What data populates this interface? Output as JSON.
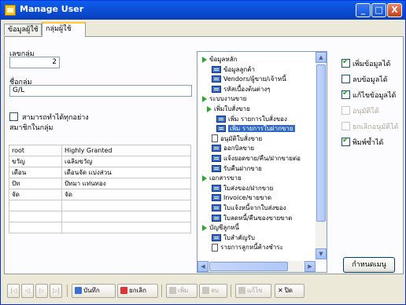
{
  "window": {
    "title": "Manage User",
    "minimize": "_",
    "maximize": "□",
    "close": "X"
  },
  "tabs": [
    {
      "label": "ข้อมูลผู้ใช้"
    },
    {
      "label": "กลุ่มผู้ใช้"
    }
  ],
  "form": {
    "group_no_label": "เลขกลุ่ม",
    "group_no_value": "2",
    "group_name_label": "ชื่อกลุ่ม",
    "group_name_value": "G/L",
    "can_do_all_label": "สามารถทำได้ทุกอย่าง",
    "members_label": "สมาชิกในกลุ่ม"
  },
  "members": [
    {
      "user": "root",
      "name": "Highly Granted"
    },
    {
      "user": "ขวัญ",
      "name": "เฉลิมขวัญ"
    },
    {
      "user": "เดือน",
      "name": "เดือนจัด แบ่งส่วน"
    },
    {
      "user": "ปัท",
      "name": "ปัทมา แท่นทอง"
    },
    {
      "user": "จัด",
      "name": "จัด"
    }
  ],
  "tree": [
    {
      "label": "ข้อมูลหลัก",
      "icon": "folder-icon"
    },
    {
      "label": "ข้อมูลลูกค้า",
      "icon": "form-icon"
    },
    {
      "label": "Vendors/ผู้ขาย/เจ้าหนี้",
      "icon": "form-icon"
    },
    {
      "label": "รหัสเบื้องต้นต่างๆ",
      "icon": "form-icon"
    },
    {
      "label": "ระบบงานขาย",
      "icon": "folder-icon"
    },
    {
      "label": "เพิ่มใบสั่งขาย",
      "icon": "folder-icon"
    },
    {
      "label": "เพิ่ม รายการใบสั่งของ",
      "icon": "form-icon"
    },
    {
      "label": "เพิ่ม รายการใบฝากขาย",
      "icon": "form-icon"
    },
    {
      "label": "อนุมัติใบสั่งขาย",
      "icon": "doc-icon"
    },
    {
      "label": "ออกบิลขาย",
      "icon": "form-icon"
    },
    {
      "label": "แจ้งยอดขาย/คืน/ฝากขายต่อ",
      "icon": "form-icon"
    },
    {
      "label": "รับคืนฝากขาย",
      "icon": "form-icon"
    },
    {
      "label": "เอกสารขาย",
      "icon": "folder-icon"
    },
    {
      "label": "ใบส่งของ/ฝากขาย",
      "icon": "form-icon"
    },
    {
      "label": "Invoice/ขายขาด",
      "icon": "form-icon"
    },
    {
      "label": "ใบแจ้งหนี้จากใบส่งของ",
      "icon": "form-icon"
    },
    {
      "label": "ใบลดหนี้/คืนของขายขาด",
      "icon": "form-icon"
    },
    {
      "label": "บัญชีลูกหนี้",
      "icon": "folder-icon"
    },
    {
      "label": "ใบสำคัญรับ",
      "icon": "form-icon"
    },
    {
      "label": "รายการลูกหนี้ค้างชำระ",
      "icon": "doc-icon"
    }
  ],
  "permissions": [
    {
      "label": "เพิ่มข้อมูลได้",
      "checked": true,
      "enabled": true
    },
    {
      "label": "ลบข้อมูลได้",
      "checked": false,
      "enabled": true
    },
    {
      "label": "แก้ไขข้อมูลได้",
      "checked": true,
      "enabled": true
    },
    {
      "label": "อนุมัติได้",
      "checked": false,
      "enabled": false
    },
    {
      "label": "ยกเลิกอนุมัติได้",
      "checked": false,
      "enabled": false
    },
    {
      "label": "พิมพ์ซ้ำได้",
      "checked": true,
      "enabled": true
    }
  ],
  "set_menu_button": "กำหนดเมนู",
  "toolbar": {
    "first": "|◁",
    "prev": "◁",
    "next": "▷",
    "last": "▷|",
    "save": "บันทึก",
    "cancel": "ยกเลิก",
    "add": "เพิ่ม",
    "delete": "ลบ",
    "edit": "แก้ไข",
    "close": "ปิด"
  },
  "colors": {
    "accent": "#316ac5",
    "title_bar": "#0a5ff0",
    "tree_folder": "#2aa82a"
  }
}
